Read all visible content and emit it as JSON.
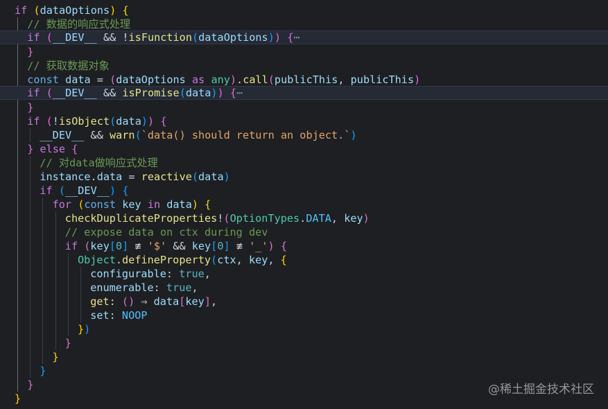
{
  "editor": {
    "lines": [
      {
        "tokens": [
          [
            "kw",
            "if"
          ],
          [
            "def",
            " "
          ],
          [
            "b1",
            "("
          ],
          [
            "var",
            "dataOptions"
          ],
          [
            "b1",
            ")"
          ],
          [
            "def",
            " "
          ],
          [
            "b1",
            "{"
          ]
        ]
      },
      {
        "tokens": [
          [
            "cm",
            "// 数据的响应式处理"
          ]
        ]
      },
      {
        "highlight": true,
        "tokens": [
          [
            "kw",
            "if"
          ],
          [
            "def",
            " "
          ],
          [
            "b2",
            "("
          ],
          [
            "var",
            "__DEV__"
          ],
          [
            "def",
            " && !"
          ],
          [
            "fn",
            "isFunction"
          ],
          [
            "b3",
            "("
          ],
          [
            "var",
            "dataOptions"
          ],
          [
            "b3",
            ")"
          ],
          [
            "b2",
            ")"
          ],
          [
            "def",
            " "
          ],
          [
            "b2",
            "{"
          ],
          [
            "fold",
            "⋯"
          ]
        ]
      },
      {
        "tokens": [
          [
            "b2",
            "}"
          ]
        ]
      },
      {
        "tokens": [
          [
            "cm",
            "// 获取数据对象"
          ]
        ]
      },
      {
        "tokens": [
          [
            "kw2",
            "const"
          ],
          [
            "def",
            " "
          ],
          [
            "var",
            "data"
          ],
          [
            "def",
            " = "
          ],
          [
            "b2",
            "("
          ],
          [
            "var",
            "dataOptions"
          ],
          [
            "def",
            " "
          ],
          [
            "kw",
            "as"
          ],
          [
            "def",
            " "
          ],
          [
            "cls",
            "any"
          ],
          [
            "b2",
            ")"
          ],
          [
            "def",
            "."
          ],
          [
            "fn",
            "call"
          ],
          [
            "b2",
            "("
          ],
          [
            "var",
            "publicThis"
          ],
          [
            "def",
            ", "
          ],
          [
            "var",
            "publicThis"
          ],
          [
            "b2",
            ")"
          ]
        ]
      },
      {
        "highlight": true,
        "tokens": [
          [
            "kw",
            "if"
          ],
          [
            "def",
            " "
          ],
          [
            "b2",
            "("
          ],
          [
            "var",
            "__DEV__"
          ],
          [
            "def",
            " && "
          ],
          [
            "fn",
            "isPromise"
          ],
          [
            "b3",
            "("
          ],
          [
            "var",
            "data"
          ],
          [
            "b3",
            ")"
          ],
          [
            "b2",
            ")"
          ],
          [
            "def",
            " "
          ],
          [
            "b2",
            "{"
          ],
          [
            "fold",
            "⋯"
          ]
        ]
      },
      {
        "tokens": [
          [
            "b2",
            "}"
          ]
        ]
      },
      {
        "tokens": [
          [
            "kw",
            "if"
          ],
          [
            "def",
            " "
          ],
          [
            "b2",
            "("
          ],
          [
            "def",
            "!"
          ],
          [
            "fn",
            "isObject"
          ],
          [
            "b3",
            "("
          ],
          [
            "var",
            "data"
          ],
          [
            "b3",
            ")"
          ],
          [
            "b2",
            ")"
          ],
          [
            "def",
            " "
          ],
          [
            "b2",
            "{"
          ]
        ]
      },
      {
        "tokens": [
          [
            "var",
            "__DEV__"
          ],
          [
            "def",
            " && "
          ],
          [
            "fn",
            "warn"
          ],
          [
            "b3",
            "("
          ],
          [
            "str",
            "`data() should return an object.`"
          ],
          [
            "b3",
            ")"
          ]
        ]
      },
      {
        "tokens": [
          [
            "b2",
            "}"
          ],
          [
            "def",
            " "
          ],
          [
            "kw",
            "else"
          ],
          [
            "def",
            " "
          ],
          [
            "b2",
            "{"
          ]
        ]
      },
      {
        "tokens": [
          [
            "cm",
            "// 对data做响应式处理"
          ]
        ]
      },
      {
        "tokens": [
          [
            "var",
            "instance"
          ],
          [
            "def",
            "."
          ],
          [
            "prop",
            "data"
          ],
          [
            "def",
            " = "
          ],
          [
            "fn",
            "reactive"
          ],
          [
            "b3",
            "("
          ],
          [
            "var",
            "data"
          ],
          [
            "b3",
            ")"
          ]
        ]
      },
      {
        "tokens": [
          [
            "kw",
            "if"
          ],
          [
            "def",
            " "
          ],
          [
            "b3",
            "("
          ],
          [
            "var",
            "__DEV__"
          ],
          [
            "b3",
            ")"
          ],
          [
            "def",
            " "
          ],
          [
            "b3",
            "{"
          ]
        ]
      },
      {
        "tokens": [
          [
            "kw",
            "for"
          ],
          [
            "def",
            " "
          ],
          [
            "b1",
            "("
          ],
          [
            "kw2",
            "const"
          ],
          [
            "def",
            " "
          ],
          [
            "var",
            "key"
          ],
          [
            "def",
            " "
          ],
          [
            "kw",
            "in"
          ],
          [
            "def",
            " "
          ],
          [
            "var",
            "data"
          ],
          [
            "b1",
            ")"
          ],
          [
            "def",
            " "
          ],
          [
            "b1",
            "{"
          ]
        ]
      },
      {
        "tokens": [
          [
            "fn",
            "checkDuplicateProperties"
          ],
          [
            "def",
            "!"
          ],
          [
            "b2",
            "("
          ],
          [
            "cls",
            "OptionTypes"
          ],
          [
            "def",
            "."
          ],
          [
            "const",
            "DATA"
          ],
          [
            "def",
            ", "
          ],
          [
            "var",
            "key"
          ],
          [
            "b2",
            ")"
          ]
        ]
      },
      {
        "tokens": [
          [
            "cm",
            "// expose data on ctx during dev"
          ]
        ]
      },
      {
        "tokens": [
          [
            "kw",
            "if"
          ],
          [
            "def",
            " "
          ],
          [
            "b2",
            "("
          ],
          [
            "var",
            "key"
          ],
          [
            "b3",
            "["
          ],
          [
            "bool",
            "0"
          ],
          [
            "b3",
            "]"
          ],
          [
            "def",
            " ≢ "
          ],
          [
            "str",
            "'$'"
          ],
          [
            "def",
            " && "
          ],
          [
            "var",
            "key"
          ],
          [
            "b3",
            "["
          ],
          [
            "bool",
            "0"
          ],
          [
            "b3",
            "]"
          ],
          [
            "def",
            " ≢ "
          ],
          [
            "str",
            "'_'"
          ],
          [
            "b2",
            ")"
          ],
          [
            "def",
            " "
          ],
          [
            "b2",
            "{"
          ]
        ]
      },
      {
        "tokens": [
          [
            "cls",
            "Object"
          ],
          [
            "def",
            "."
          ],
          [
            "fn",
            "defineProperty"
          ],
          [
            "b3",
            "("
          ],
          [
            "var",
            "ctx"
          ],
          [
            "def",
            ", "
          ],
          [
            "var",
            "key"
          ],
          [
            "def",
            ", "
          ],
          [
            "b1",
            "{"
          ]
        ]
      },
      {
        "tokens": [
          [
            "prop",
            "configurable"
          ],
          [
            "def",
            ": "
          ],
          [
            "bool",
            "true"
          ],
          [
            "def",
            ","
          ]
        ]
      },
      {
        "tokens": [
          [
            "prop",
            "enumerable"
          ],
          [
            "def",
            ": "
          ],
          [
            "bool",
            "true"
          ],
          [
            "def",
            ","
          ]
        ]
      },
      {
        "tokens": [
          [
            "fn",
            "get"
          ],
          [
            "def",
            ": "
          ],
          [
            "b2",
            "()"
          ],
          [
            "def",
            " ⇒ "
          ],
          [
            "var",
            "data"
          ],
          [
            "b2",
            "["
          ],
          [
            "var",
            "key"
          ],
          [
            "b2",
            "]"
          ],
          [
            "def",
            ","
          ]
        ]
      },
      {
        "tokens": [
          [
            "prop",
            "set"
          ],
          [
            "def",
            ": "
          ],
          [
            "const",
            "NOOP"
          ]
        ]
      },
      {
        "tokens": [
          [
            "b1",
            "}"
          ],
          [
            "b3",
            ")"
          ]
        ]
      },
      {
        "tokens": [
          [
            "b2",
            "}"
          ]
        ]
      },
      {
        "tokens": [
          [
            "b1",
            "}"
          ]
        ]
      },
      {
        "tokens": [
          [
            "b3",
            "}"
          ]
        ]
      },
      {
        "tokens": [
          [
            "b2",
            "}"
          ]
        ]
      },
      {
        "tokens": [
          [
            "b1",
            "}"
          ]
        ]
      }
    ]
  },
  "watermark": "@稀土掘金技术社区"
}
